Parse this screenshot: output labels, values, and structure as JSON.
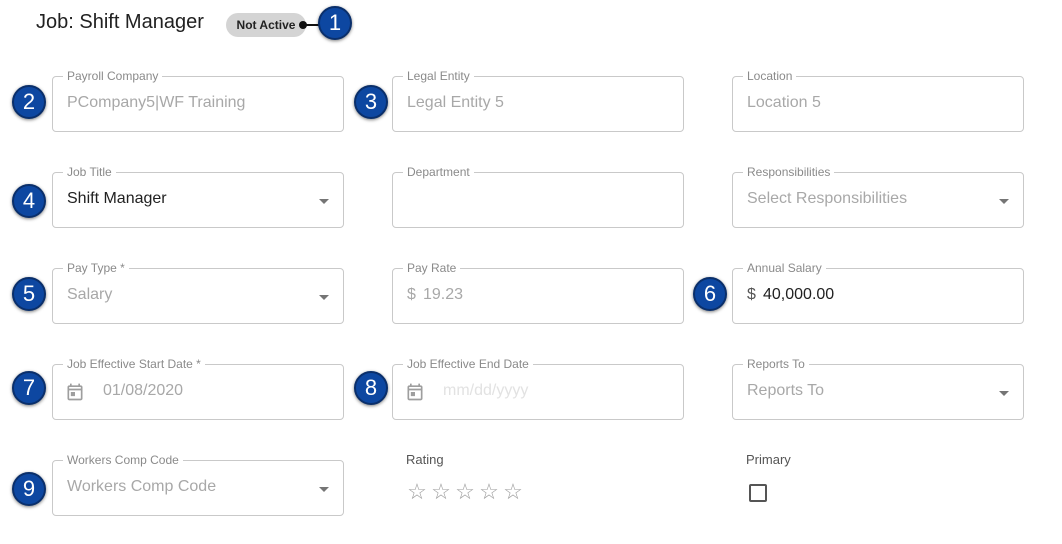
{
  "header": {
    "title": "Job: Shift Manager",
    "status_badge": "Not Active"
  },
  "callouts": [
    "1",
    "2",
    "3",
    "4",
    "5",
    "6",
    "7",
    "8",
    "9"
  ],
  "fields": {
    "payroll_company": {
      "label": "Payroll Company",
      "value": "PCompany5|WF Training"
    },
    "legal_entity": {
      "label": "Legal Entity",
      "value": "Legal Entity 5"
    },
    "location": {
      "label": "Location",
      "value": "Location 5"
    },
    "job_title": {
      "label": "Job Title",
      "value": "Shift Manager"
    },
    "department": {
      "label": "Department",
      "value": ""
    },
    "responsibilities": {
      "label": "Responsibilities",
      "placeholder": "Select Responsibilities"
    },
    "pay_type": {
      "label": "Pay Type *",
      "value": "Salary"
    },
    "pay_rate": {
      "label": "Pay Rate",
      "prefix": "$",
      "value": "19.23"
    },
    "annual_salary": {
      "label": "Annual Salary",
      "prefix": "$",
      "value": "40,000.00"
    },
    "job_start_date": {
      "label": "Job Effective Start Date *",
      "value": "01/08/2020"
    },
    "job_end_date": {
      "label": "Job Effective End Date",
      "placeholder": "mm/dd/yyyy"
    },
    "reports_to": {
      "label": "Reports To",
      "placeholder": "Reports To"
    },
    "workers_comp": {
      "label": "Workers Comp Code",
      "placeholder": "Workers Comp Code"
    },
    "rating": {
      "label": "Rating",
      "value": 0,
      "max": 5
    },
    "primary": {
      "label": "Primary",
      "checked": false
    }
  },
  "icons": {
    "dropdown": "chevron-down-icon",
    "calendar": "calendar-icon",
    "star": "star-outline-icon"
  },
  "colors": {
    "callout": "#0d47a1",
    "badge": "#d4d4d4",
    "border": "#c9c9c9"
  }
}
